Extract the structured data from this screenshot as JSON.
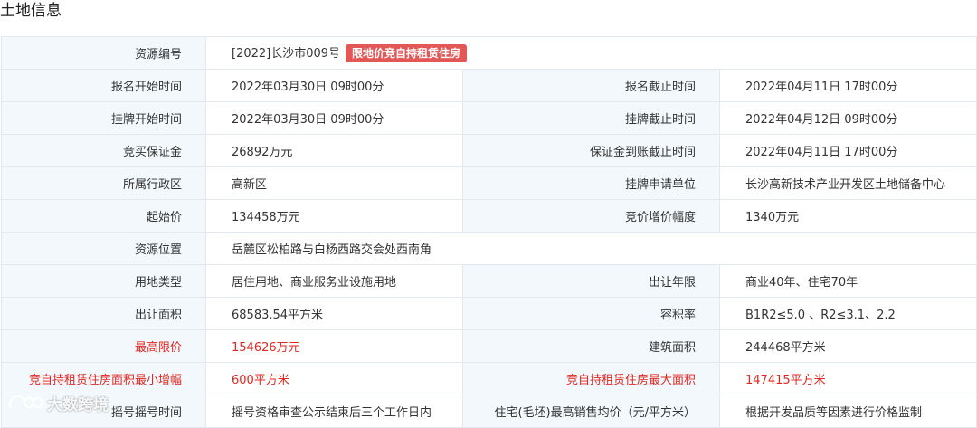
{
  "section_title": "土地信息",
  "badge": "限地价竞自持租赁住房",
  "watermark": "大数跨境",
  "rows": [
    {
      "label1": "资源编号",
      "value1": "[2022]长沙市009号"
    },
    {
      "label1": "报名开始时间",
      "value1": "2022年03月30日 09时00分",
      "label2": "报名截止时间",
      "value2": "2022年04月11日 17时00分"
    },
    {
      "label1": "挂牌开始时间",
      "value1": "2022年03月30日 09时00分",
      "label2": "挂牌截止时间",
      "value2": "2022年04月12日 09时00分"
    },
    {
      "label1": "竞买保证金",
      "value1": "26892万元",
      "label2": "保证金到账截止时间",
      "value2": "2022年04月11日 17时00分"
    },
    {
      "label1": "所属行政区",
      "value1": "高新区",
      "label2": "挂牌申请单位",
      "value2": "长沙高新技术产业开发区土地储备中心"
    },
    {
      "label1": "起始价",
      "value1": "134458万元",
      "label2": "竞价增价幅度",
      "value2": "1340万元"
    },
    {
      "label1": "资源位置",
      "value1": "岳麓区松柏路与白杨西路交会处西南角"
    },
    {
      "label1": "用地类型",
      "value1": "居住用地、商业服务业设施用地",
      "label2": "出让年限",
      "value2": "商业40年、住宅70年"
    },
    {
      "label1": "出让面积",
      "value1": "68583.54平方米",
      "label2": "容积率",
      "value2": "B1R2≤5.0 、R2≤3.1、2.2"
    },
    {
      "label1": "最高限价",
      "value1": "154626万元",
      "label2": "建筑面积",
      "value2": "244468平方米"
    },
    {
      "label1": "竞自持租赁住房面积最小增幅",
      "value1": "600平方米",
      "label2": "竞自持租赁住房最大面积",
      "value2": "147415平方米"
    },
    {
      "label1": "摇号摇号时间",
      "value1": "摇号资格审查公示结束后三个工作日内",
      "label2": "住宅(毛坯)最高销售均价（元/平方米）",
      "value2": "根据开发品质等因素进行价格监制"
    }
  ],
  "colors": {
    "label_bg": "#f2f8fc",
    "highlight": "#e0271f",
    "badge_bg": "#e35757",
    "border": "#e3e8ee"
  }
}
